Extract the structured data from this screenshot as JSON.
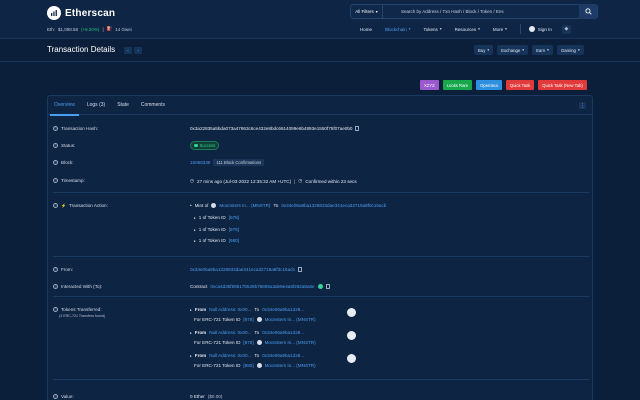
{
  "header": {
    "brand": "Etherscan",
    "eth_price_prefix": "Eth:",
    "eth_price": "$1,098.58",
    "eth_change": "(+8.20%)",
    "gas": "14 Gwei",
    "filter_label": "All Filters",
    "search_placeholder": "Search by Address / Txn Hash / Block / Token / Ens",
    "nav": [
      "Home",
      "Blockchain",
      "Tokens",
      "Resources",
      "More"
    ],
    "signin": "Sign In"
  },
  "titlebar": {
    "title": "Transaction Details",
    "prev": "‹",
    "next": "›",
    "menus": [
      "Buy",
      "Exchange",
      "Earn",
      "Gaming"
    ]
  },
  "actions": [
    {
      "label": "XZYZ",
      "color": "#9b59d0"
    },
    {
      "label": "Looks Rare",
      "color": "#18a84c"
    },
    {
      "label": "OpenSea",
      "color": "#2f8fe0"
    },
    {
      "label": "Quick Task",
      "color": "#e23a3a"
    },
    {
      "label": "Quick Task (New Tab)",
      "color": "#e23a3a"
    }
  ],
  "tabs": [
    "Overview",
    "Logs (3)",
    "State",
    "Comments"
  ],
  "details": {
    "tx_hash_label": "Transaction Hash:",
    "tx_hash": "0x3a22835a5bda073a47863c6ce432e8bdc6614099e6b4893e1550f75f07ae0b0",
    "status_label": "Status:",
    "status": "Success",
    "block_label": "Block:",
    "block": "15066338",
    "confirmations": "111 Block Confirmations",
    "timestamp_label": "Timestamp:",
    "timestamp": "27 mins ago (Jul-03-2022 12:35:32 AM +UTC)",
    "confirmed_within": "Confirmed within 23 secs",
    "action_label": "Transaction Action:",
    "mint_prefix": "Mint of",
    "mint_token": "Moonsters In... (MNSTR)",
    "mint_to": "To",
    "mint_to_addr": "0x34e06a9ba1328833dae341eca32719a8f0c16acb",
    "mint_items": [
      {
        "text": "1 of Token ID",
        "id": "[978]"
      },
      {
        "text": "1 of Token ID",
        "id": "[979]"
      },
      {
        "text": "1 of Token ID",
        "id": "[980]"
      }
    ],
    "from_label": "From:",
    "from": "0x34e06a9ba1328833dae341eca32719a8f3c16acb",
    "interacted_label": "Interacted With (To):",
    "contract_prefix": "Contract",
    "contract": "0xca4d35f89517b528b78655a3de8e4a5f262a8a6e",
    "tokens_label": "Tokens Transferred:",
    "tokens_sub": "(3 ERC-721 Transfers found)",
    "transfers": [
      {
        "from": "Null Address: 0x00...",
        "to_prefix": "To",
        "to": "0x34e06a9ba1328...",
        "type": "For ERC-721 Token ID",
        "id": "[978]",
        "token": "Moonsters In... (MNSTR)"
      },
      {
        "from": "Null Address: 0x00...",
        "to_prefix": "To",
        "to": "0x34e06a9ba1328...",
        "type": "For ERC-721 Token ID",
        "id": "[979]",
        "token": "Moonsters In... (MNSTR)"
      },
      {
        "from": "Null Address: 0x00...",
        "to_prefix": "To",
        "to": "0x34e06a9ba1328...",
        "type": "For ERC-721 Token ID",
        "id": "[980]",
        "token": "Moonsters In... (MNSTR)"
      }
    ],
    "from_word": "From",
    "value_label": "Value:",
    "value": "0 Ether",
    "value_usd": "($0.00)"
  },
  "colors": {
    "background": "#0b1e3a",
    "card": "#0e2443",
    "link": "#4a9ef0",
    "success": "#34d399"
  }
}
